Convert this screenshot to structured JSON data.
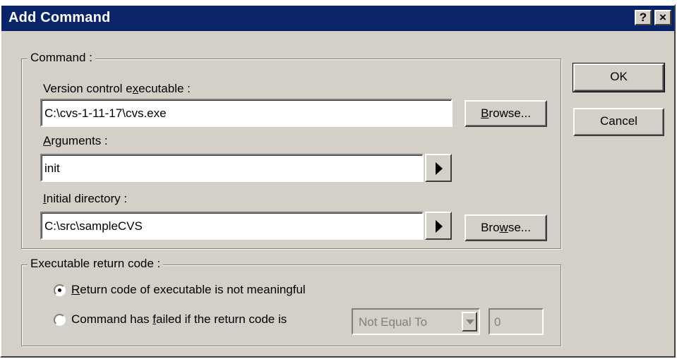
{
  "window": {
    "title": "Add Command",
    "help_label": "?",
    "close_label": "×"
  },
  "command_group": {
    "label": "Command :",
    "executable_label_pre": "Version control e",
    "executable_label_u": "x",
    "executable_label_post": "ecutable :",
    "executable_value": "C:\\cvs-1-11-17\\cvs.exe",
    "browse1_pre": "",
    "browse1_u": "B",
    "browse1_post": "rowse...",
    "arguments_label_u": "A",
    "arguments_label_post": "rguments :",
    "arguments_value": "init",
    "initial_dir_label_u": "I",
    "initial_dir_label_post": "nitial directory :",
    "initial_dir_value": "C:\\src\\sampleCVS",
    "browse2_pre": "Bro",
    "browse2_u": "w",
    "browse2_post": "se..."
  },
  "return_group": {
    "label": "Executable return code :",
    "option1_u": "R",
    "option1_post": "eturn code of executable is not meaningful",
    "option1_selected": true,
    "option2_pre": "Command has ",
    "option2_u": "f",
    "option2_post": "ailed if the return code is",
    "option2_selected": false,
    "comparison_value": "Not Equal To",
    "return_code_value": "0"
  },
  "buttons": {
    "ok_label": "OK",
    "cancel_label": "Cancel"
  },
  "icons": {
    "arguments_arrow": "right-triangle-icon",
    "initial_dir_arrow": "right-triangle-icon",
    "combo_drop": "chevron-down-icon"
  }
}
